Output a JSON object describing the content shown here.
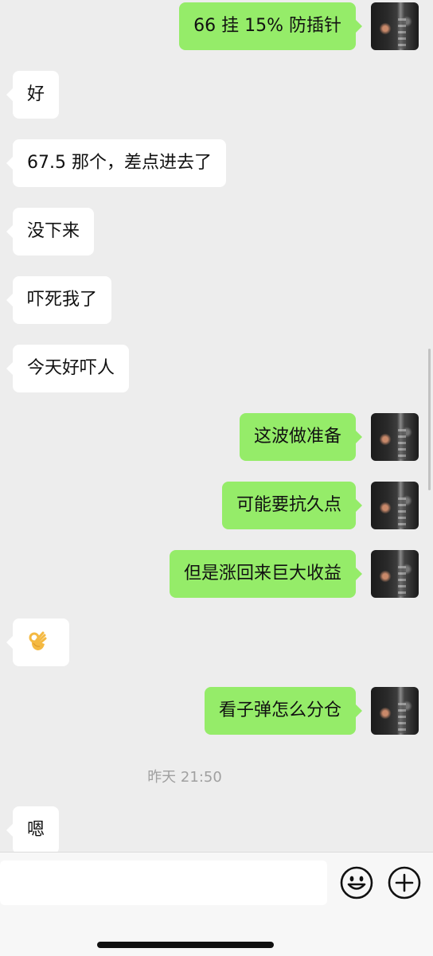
{
  "messages": [
    {
      "side": "right",
      "text": "66 挂 15% 防插针"
    },
    {
      "side": "left",
      "text": "好"
    },
    {
      "side": "left",
      "text": "67.5 那个，差点进去了"
    },
    {
      "side": "left",
      "text": "没下来"
    },
    {
      "side": "left",
      "text": "吓死我了"
    },
    {
      "side": "left",
      "text": "今天好吓人"
    },
    {
      "side": "right",
      "text": "这波做准备"
    },
    {
      "side": "right",
      "text": "可能要抗久点"
    },
    {
      "side": "right",
      "text": "但是涨回来巨大收益"
    },
    {
      "side": "left",
      "emoji": "ok-hand"
    },
    {
      "side": "right",
      "text": "看子弹怎么分仓"
    },
    {
      "side": "left",
      "text": "嗯"
    }
  ],
  "timestamp": "昨天 21:50",
  "input": {
    "value": ""
  },
  "icons": {
    "emoji_button": "smiley-face-icon",
    "more_button": "plus-circle-icon"
  },
  "colors": {
    "background": "#ededed",
    "outgoing_bubble": "#95ec69",
    "incoming_bubble": "#ffffff",
    "timestamp": "#a0a0a0"
  }
}
